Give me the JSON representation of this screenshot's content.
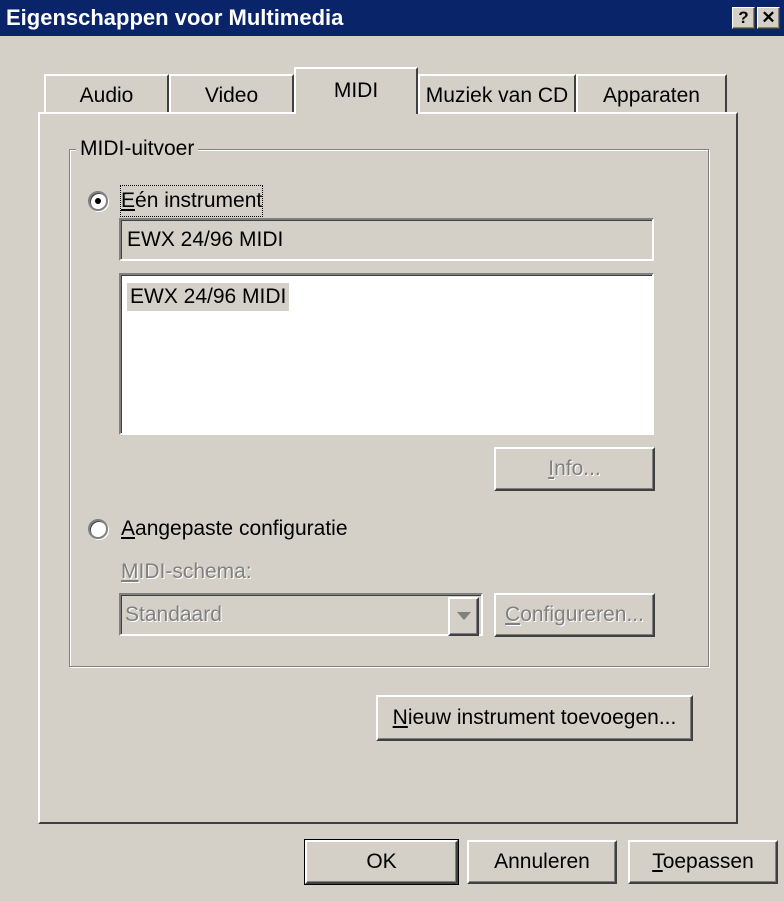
{
  "window": {
    "title": "Eigenschappen voor Multimedia",
    "help_button": "?",
    "close_button": "✕"
  },
  "tabs": [
    {
      "label": "Audio",
      "selected": false
    },
    {
      "label": "Video",
      "selected": false
    },
    {
      "label": "MIDI",
      "selected": true
    },
    {
      "label": "Muziek van CD",
      "selected": false
    },
    {
      "label": "Apparaten",
      "selected": false
    }
  ],
  "midi_output": {
    "group_label": "MIDI-uitvoer",
    "single_instrument": {
      "label_accel": "E",
      "label_rest": "én instrument",
      "checked": true,
      "current_value": "EWX 24/96 MIDI",
      "list_items": [
        "EWX 24/96 MIDI"
      ],
      "info_button_accel": "I",
      "info_button_rest": "nfo..."
    },
    "custom_config": {
      "label_accel": "A",
      "label_rest": "angepaste configuratie",
      "checked": false,
      "scheme_label_accel": "M",
      "scheme_label_rest": "IDI-schema:",
      "scheme_value": "Standaard",
      "configure_button_accel": "C",
      "configure_button_rest": "onfigureren..."
    }
  },
  "add_instrument_button": {
    "accel": "N",
    "rest": "ieuw instrument toevoegen..."
  },
  "footer": {
    "ok": "OK",
    "cancel": "Annuleren",
    "apply_accel": "T",
    "apply_rest": "oepassen"
  },
  "colors": {
    "titlebar": "#0a246a",
    "face": "#d4d0c8",
    "disabled_text": "#808080"
  }
}
